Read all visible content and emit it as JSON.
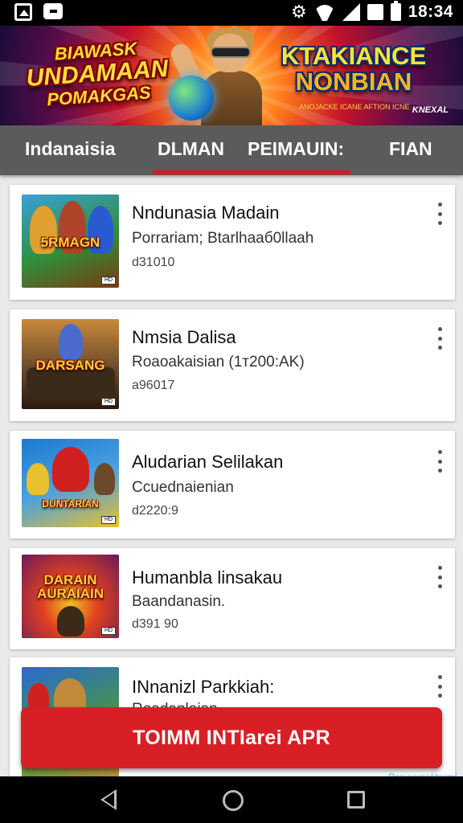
{
  "status_bar": {
    "time": "18:34",
    "icons": [
      "image-icon",
      "message-icon",
      "settings-icon",
      "wifi-icon",
      "signal-icon",
      "sim-icon",
      "battery-icon"
    ]
  },
  "banner": {
    "left_title_line1": "BIAWASK",
    "left_title_line2": "UNDAMAAN",
    "left_title_line3": "POMAKGAS",
    "right_title_line1": "KTAKIANCE",
    "right_title_line2": "NONBIAN",
    "tagline": "ANOJACKE ICANE AFTION ICNE",
    "corner_text": "KNEXAL"
  },
  "tabs": [
    {
      "label": "Indanaisia"
    },
    {
      "label": "DLMAN"
    },
    {
      "label": "PEIMAUIN:"
    },
    {
      "label": "FIAN"
    }
  ],
  "active_tab_index": 1,
  "apps": [
    {
      "title": "Nndunasia Madain",
      "subtitle": "Porrariam; Btarlhaaб0llaah",
      "meta": "d31010",
      "thumb_text": "5RMAGN",
      "thumb_colors": [
        "#2f8f3a",
        "#e0a030",
        "#7a3a10"
      ]
    },
    {
      "title": "Nmsia Dalisa",
      "subtitle": "Roaoakaisian (1т200:AK)",
      "meta": "a96017",
      "thumb_text": "DARSANG",
      "thumb_colors": [
        "#6a4a2a",
        "#c98a3a",
        "#2a1a10"
      ]
    },
    {
      "title": "Aludarian Selilakan",
      "subtitle": "Ccuednaienian",
      "meta": "d2220:9",
      "thumb_text": "DUNTARIAN",
      "thumb_colors": [
        "#1a7ad0",
        "#e8c030",
        "#d02020"
      ]
    },
    {
      "title": "Humanbla linsakau",
      "subtitle": "Baandanasin.",
      "meta": "d391 90",
      "thumb_text": "DARAIN AURAIAIN",
      "thumb_colors": [
        "#6a1a5a",
        "#e04020",
        "#f0c020"
      ]
    },
    {
      "title": "INnanizl Parkkiah:",
      "subtitle": "Roadanlaian",
      "meta": "",
      "thumb_text": "",
      "thumb_colors": [
        "#2a6ad0",
        "#4a9a3a",
        "#c08a3a"
      ]
    }
  ],
  "install_button": {
    "label": "TOIMM INTIarei APR"
  },
  "watermark": "Powesmektermi",
  "colors": {
    "accent": "#d81f26",
    "tab_bar": "#5b5b5b",
    "background": "#e9e9e9"
  }
}
